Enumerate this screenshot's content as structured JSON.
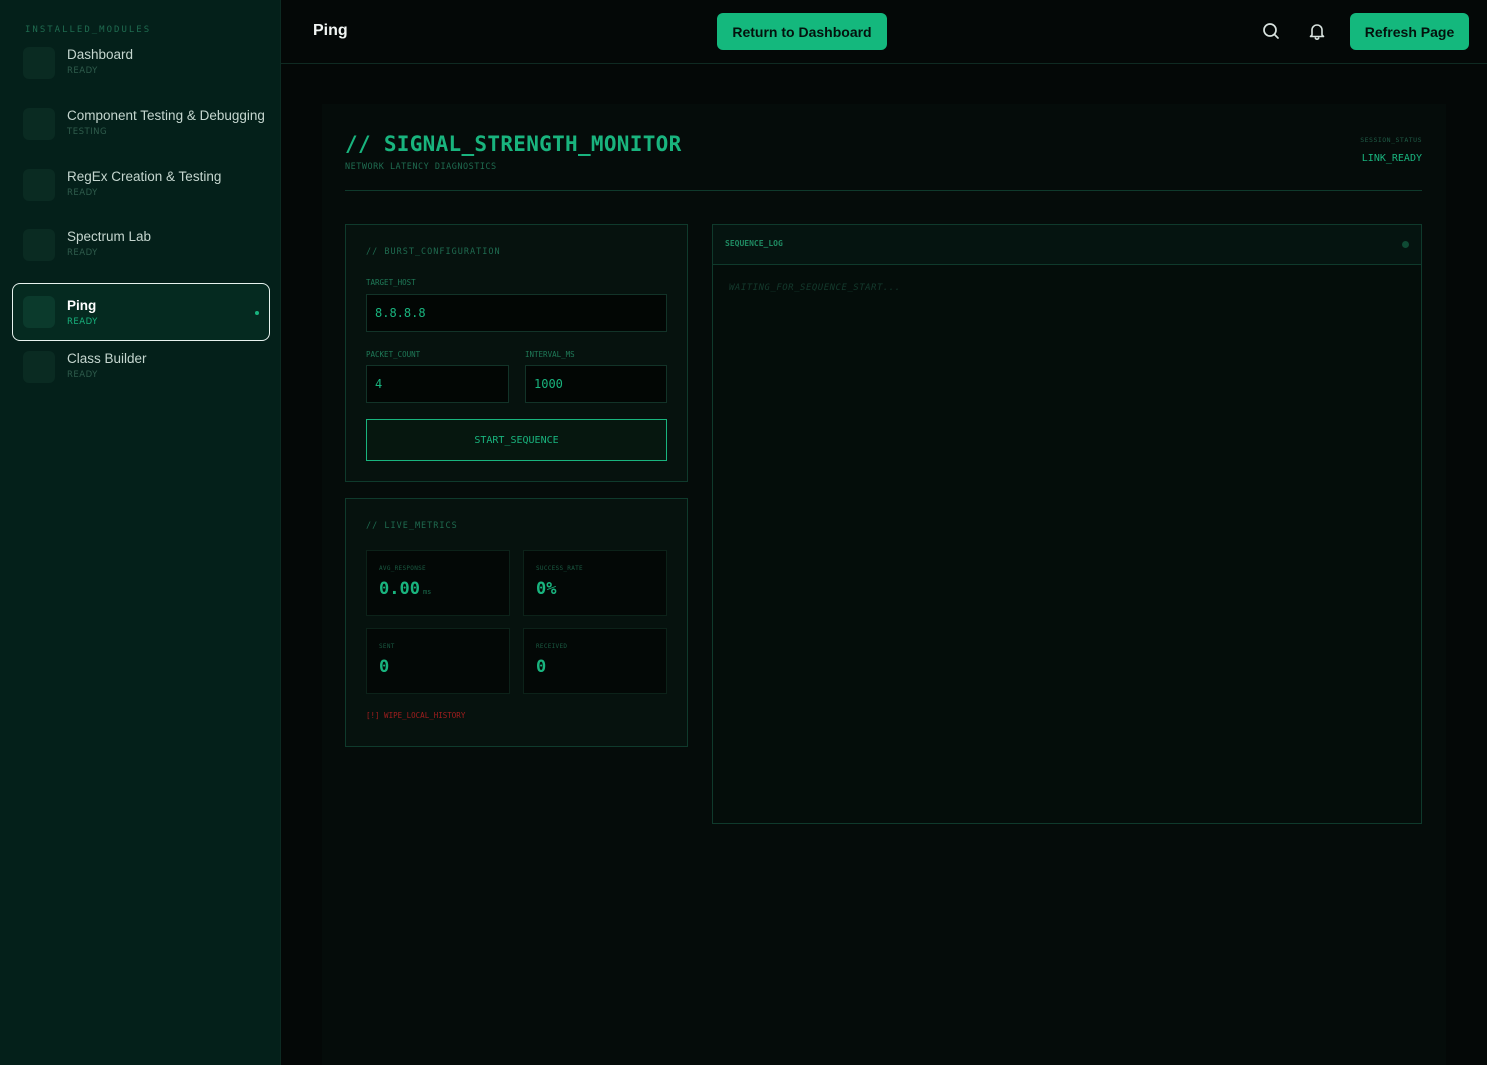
{
  "sidebar": {
    "title": "INSTALLED_MODULES",
    "items": [
      {
        "label": "Dashboard",
        "status": "READY"
      },
      {
        "label": "Component Testing & Debugging",
        "status": "TESTING"
      },
      {
        "label": "RegEx Creation & Testing",
        "status": "READY"
      },
      {
        "label": "Spectrum Lab",
        "status": "READY"
      },
      {
        "label": "Ping",
        "status": "READY",
        "active": true
      },
      {
        "label": "Class Builder",
        "status": "READY"
      }
    ]
  },
  "header": {
    "title": "Ping",
    "return_label": "Return to Dashboard",
    "refresh_label": "Refresh Page",
    "icons": [
      "search-icon",
      "bell-icon"
    ]
  },
  "monitor": {
    "title": "// SIGNAL_STRENGTH_MONITOR",
    "subtitle": "NETWORK LATENCY DIAGNOSTICS",
    "session_label": "SESSION_STATUS",
    "session_value": "LINK_READY"
  },
  "config": {
    "title": "// BURST_CONFIGURATION",
    "target_host_label": "TARGET_HOST",
    "target_host_value": "8.8.8.8",
    "packet_count_label": "PACKET_COUNT",
    "packet_count_value": "4",
    "interval_label": "INTERVAL_MS",
    "interval_value": "1000",
    "start_label": "START_SEQUENCE"
  },
  "metrics": {
    "title": "// LIVE_METRICS",
    "avg_label": "AVG_RESPONSE",
    "avg_value": "0.00",
    "avg_unit": "ms",
    "success_label": "SUCCESS_RATE",
    "success_value": "0%",
    "sent_label": "SENT",
    "sent_value": "0",
    "received_label": "RECEIVED",
    "received_value": "0",
    "wipe_label": "[!] WIPE_LOCAL_HISTORY"
  },
  "log": {
    "title": "SEQUENCE_LOG",
    "placeholder": "WAITING_FOR_SEQUENCE_START..."
  },
  "colors": {
    "accent": "#19b47e",
    "button": "#14b87d",
    "danger": "#a11e1e",
    "sidebar_bg": "#04201a"
  }
}
